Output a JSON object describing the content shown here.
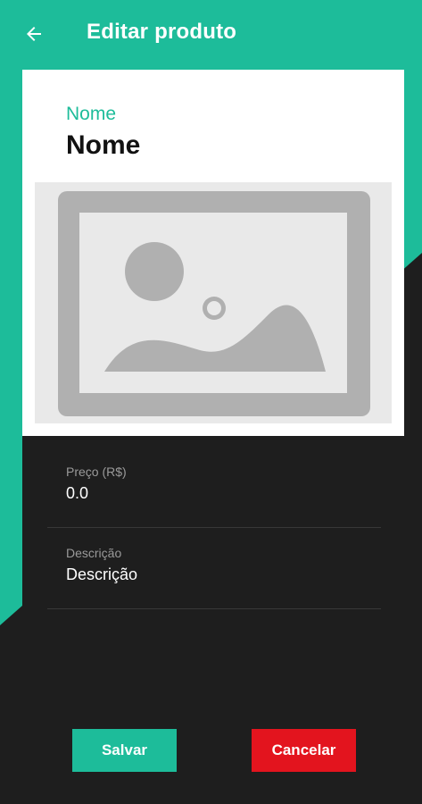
{
  "appbar": {
    "title": "Editar produto",
    "back_icon": "arrow-left-icon"
  },
  "product": {
    "name_label": "Nome",
    "name_value": "Nome",
    "image_icon": "image-placeholder-icon"
  },
  "fields": [
    {
      "label": "Preço (R$)",
      "value": "0.0"
    },
    {
      "label": "Descrição",
      "value": "Descrição"
    }
  ],
  "actions": {
    "save_label": "Salvar",
    "cancel_label": "Cancelar"
  },
  "colors": {
    "accent": "#1dbc9a",
    "danger": "#e3141e",
    "background": "#1e1e1e"
  }
}
